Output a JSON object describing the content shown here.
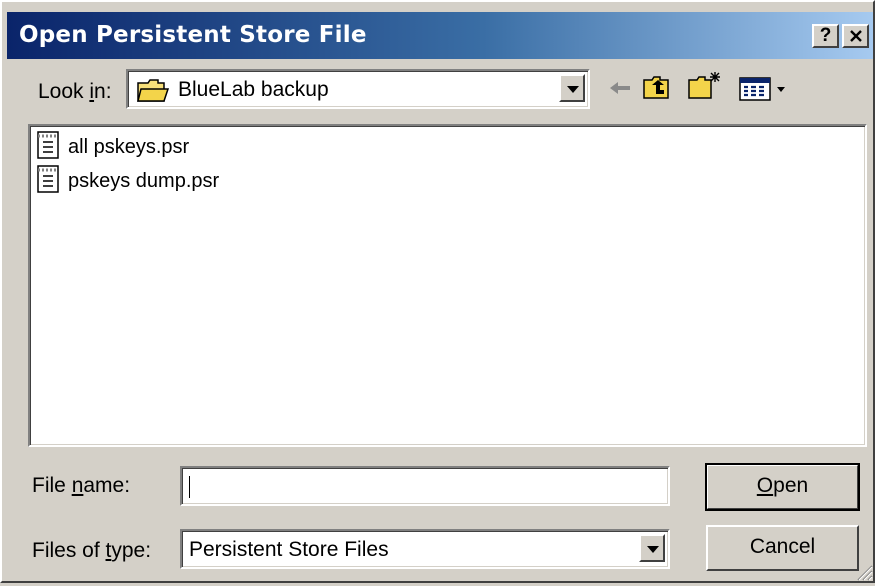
{
  "window": {
    "title": "Open Persistent Store File",
    "help_button": "?",
    "close_button": "×"
  },
  "look_in": {
    "label_pre": "Look ",
    "label_accel": "i",
    "label_post": "n:",
    "value": "BlueLab backup",
    "icon": "folder-icon"
  },
  "toolbar": {
    "icons": [
      "back-arrow-icon",
      "up-one-level-icon",
      "create-new-folder-icon",
      "view-menu-icon"
    ]
  },
  "files": [
    {
      "name": "all pskeys.psr",
      "icon": "document-icon"
    },
    {
      "name": "pskeys dump.psr",
      "icon": "document-icon"
    }
  ],
  "file_name": {
    "label_pre": "File ",
    "label_accel": "n",
    "label_post": "ame:",
    "value": ""
  },
  "file_type": {
    "label_pre": "Files of ",
    "label_accel": "t",
    "label_post": "ype:",
    "value": "Persistent Store Files"
  },
  "buttons": {
    "open_accel": "O",
    "open_rest": "pen",
    "cancel": "Cancel"
  },
  "colors": {
    "title_start": "#0a246a",
    "title_end": "#a6caf0",
    "face": "#d4d0c8"
  }
}
